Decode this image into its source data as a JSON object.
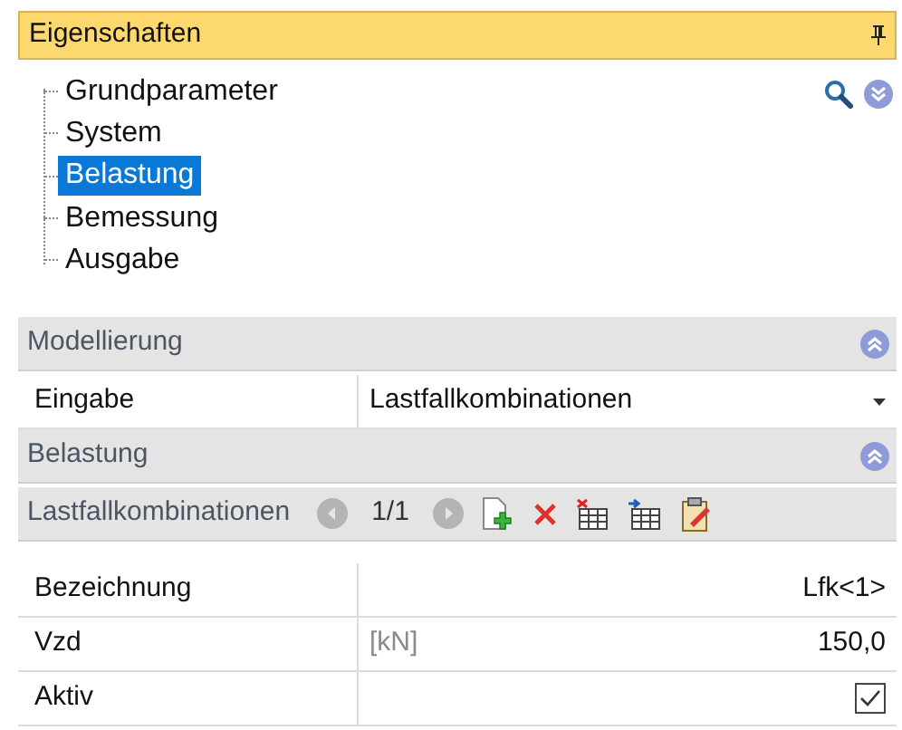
{
  "panel": {
    "title": "Eigenschaften"
  },
  "tree": [
    {
      "label": "Grundparameter",
      "selected": false
    },
    {
      "label": "System",
      "selected": false
    },
    {
      "label": "Belastung",
      "selected": true
    },
    {
      "label": "Bemessung",
      "selected": false
    },
    {
      "label": "Ausgabe",
      "selected": false
    }
  ],
  "sections": [
    {
      "title": "Modellierung",
      "expanded": true,
      "rows": [
        {
          "kind": "dropdown",
          "label": "Eingabe",
          "value": "Lastfallkombinationen"
        }
      ]
    },
    {
      "title": "Belastung",
      "expanded": true,
      "navigator": {
        "label": "Lastfallkombinationen",
        "counter": "1/1"
      },
      "rows": [
        {
          "kind": "text",
          "label": "Bezeichnung",
          "value": "Lfk<1>"
        },
        {
          "kind": "number",
          "label": "Vzd",
          "unit": "[kN]",
          "value": "150,0"
        },
        {
          "kind": "checkbox",
          "label": "Aktiv",
          "checked": true
        }
      ]
    }
  ]
}
